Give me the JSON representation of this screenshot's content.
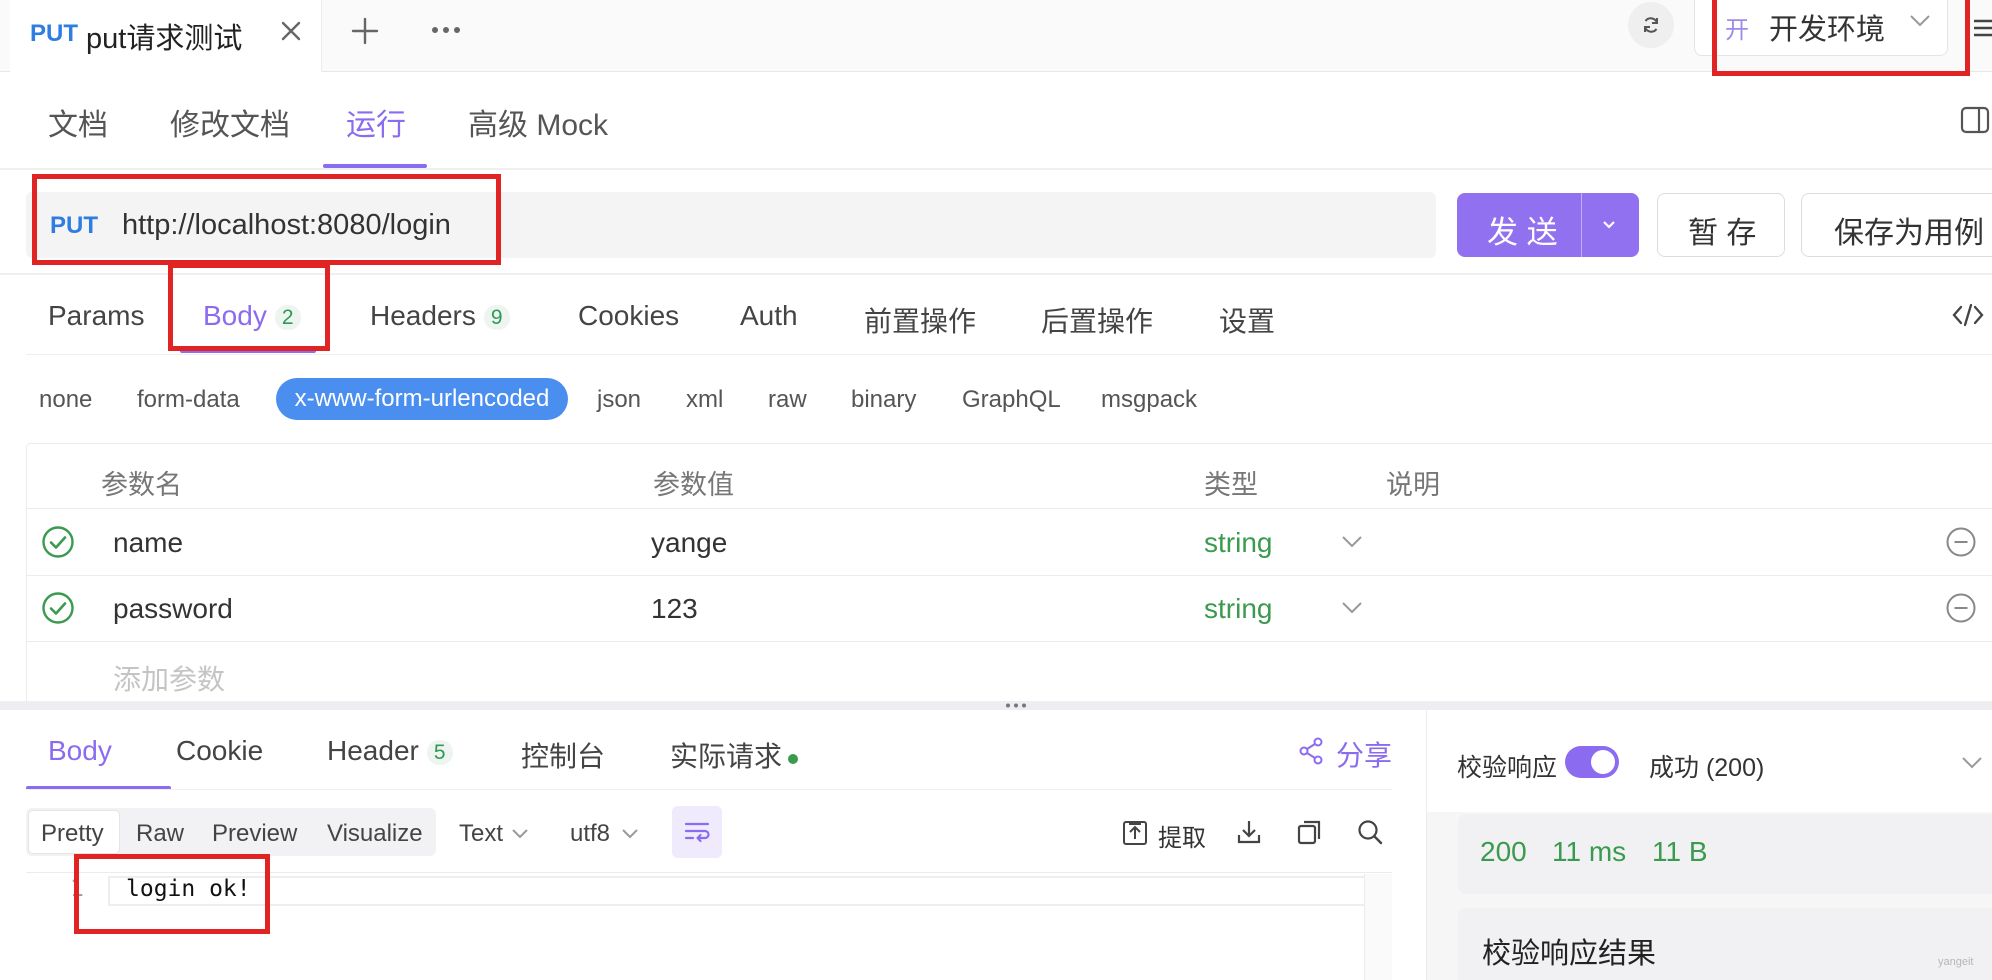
{
  "request_tab": {
    "method": "PUT",
    "title": "put请求测试"
  },
  "environment": {
    "badge": "开",
    "name": "开发环境"
  },
  "nav_tabs": [
    "文档",
    "修改文档",
    "运行",
    "高级 Mock"
  ],
  "active_nav_tab": "运行",
  "url_bar": {
    "method": "PUT",
    "url": "http://localhost:8080/login"
  },
  "buttons": {
    "send": "发 送",
    "save": "暂 存",
    "save_as_case": "保存为用例"
  },
  "request_tabs": {
    "params": "Params",
    "body": "Body",
    "body_count": "2",
    "headers": "Headers",
    "headers_count": "9",
    "cookies": "Cookies",
    "auth": "Auth",
    "pre_ops": "前置操作",
    "post_ops": "后置操作",
    "settings": "设置"
  },
  "body_types": [
    "none",
    "form-data",
    "x-www-form-urlencoded",
    "json",
    "xml",
    "raw",
    "binary",
    "GraphQL",
    "msgpack"
  ],
  "selected_body_type": "x-www-form-urlencoded",
  "params_table": {
    "headers": [
      "参数名",
      "参数值",
      "类型",
      "说明"
    ],
    "rows": [
      {
        "name": "name",
        "value": "yange",
        "type": "string",
        "description": ""
      },
      {
        "name": "password",
        "value": "123",
        "type": "string",
        "description": ""
      }
    ],
    "add_placeholder": "添加参数"
  },
  "response_tabs": {
    "body": "Body",
    "cookie": "Cookie",
    "header": "Header",
    "header_count": "5",
    "console": "控制台",
    "actual_request": "实际请求",
    "share": "分享"
  },
  "response_view": {
    "modes": [
      "Pretty",
      "Raw",
      "Preview",
      "Visualize"
    ],
    "active_mode": "Pretty",
    "format": "Text",
    "encoding": "utf8",
    "extract": "提取"
  },
  "response_body": {
    "line_number": "1",
    "content": "login ok!"
  },
  "validation": {
    "label": "校验响应",
    "enabled": true,
    "result": "成功 (200)",
    "status_code": "200",
    "time": "11 ms",
    "size": "11 B",
    "results_title": "校验响应结果"
  },
  "watermark": "yangeit",
  "colors": {
    "accent": "#8b6cf0",
    "send_button": "#9271f0",
    "method_put": "#2f7de1",
    "selected_pill": "#4a8ff0",
    "success": "#3a9a4e",
    "annotation_red": "#e02424"
  }
}
